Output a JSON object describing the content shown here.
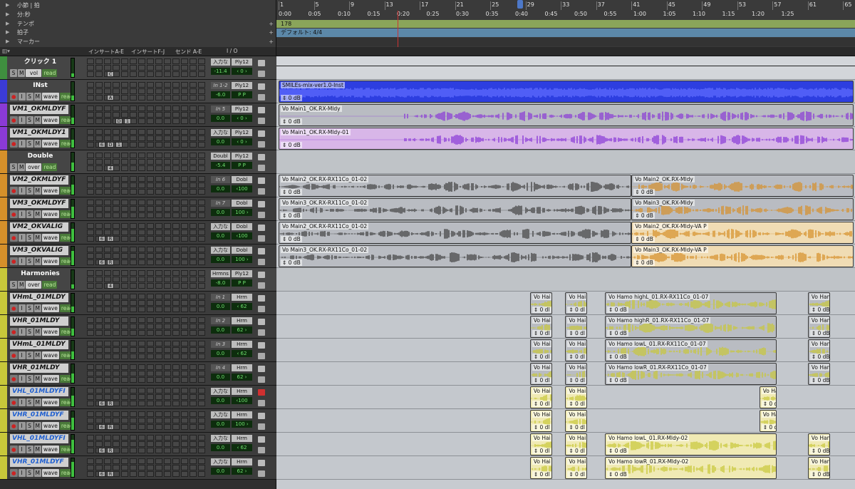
{
  "ruler": {
    "rows": [
      {
        "label": "小節 | 拍",
        "has_plus": false
      },
      {
        "label": "分:秒",
        "has_plus": false
      },
      {
        "label": "テンポ",
        "has_plus": true
      },
      {
        "label": "拍子",
        "has_plus": true
      },
      {
        "label": "マーカー",
        "has_plus": true
      }
    ],
    "bars": [
      "1",
      "5",
      "9",
      "13",
      "17",
      "21",
      "25",
      "29",
      "33",
      "37",
      "41",
      "45",
      "49",
      "53",
      "57",
      "61",
      "65"
    ],
    "minsec": [
      "0:00",
      "0:05",
      "0:10",
      "0:15",
      "0:20",
      "0:25",
      "0:30",
      "0:35",
      "0:40",
      "0:45",
      "0:50",
      "0:55",
      "1:00",
      "1:05",
      "1:10",
      "1:15",
      "1:20",
      "1:25"
    ],
    "tempo": "178",
    "meter": "デフォルト: 4/4"
  },
  "columns": {
    "insert_ae": "インサートA-E",
    "insert_fj": "インサートF-J",
    "send_ae": "センド A-E",
    "io": "I / O"
  },
  "tracks": [
    {
      "name": "クリック 1",
      "type": "master",
      "color": "#3f8f3f",
      "mode": "vol",
      "auto": "read",
      "in": "入力な",
      "out": "Ply12",
      "vol": "-11.4",
      "pan": "‹ 0 ›",
      "inserts": [
        "",
        "C"
      ],
      "buttons": [
        "S",
        "M"
      ]
    },
    {
      "name": "INst",
      "type": "master",
      "color": "#3b3bd6",
      "mode": "wave",
      "auto": "read",
      "in": "In 1-2",
      "out": "Ply12",
      "vol": "-6.0",
      "pan": "P  P",
      "inserts": [
        "",
        "A"
      ],
      "buttons": [
        "●",
        "I",
        "S",
        "M"
      ]
    },
    {
      "name": "VM1_OKMLDYF",
      "type": "audio",
      "color": "#8a3ad6",
      "mode": "wave",
      "auto": "read",
      "in": "In 5",
      "out": "Ply12",
      "vol": "0.0",
      "pan": "‹ 0 ›",
      "inserts": [
        "",
        ""
      ],
      "buttons": [
        "●",
        "I",
        "S",
        "M"
      ],
      "extra": [
        "D",
        "1"
      ]
    },
    {
      "name": "VM1_OKMLDY1",
      "type": "audio",
      "color": "#8a3ad6",
      "mode": "wave",
      "auto": "read",
      "in": "入力な",
      "out": "Ply12",
      "vol": "0.0",
      "pan": "‹ 0 ›",
      "inserts": [
        "6",
        "D",
        "1"
      ],
      "buttons": [
        "●",
        "I",
        "S",
        "M"
      ]
    },
    {
      "name": "Double",
      "type": "master",
      "color": "#d6902a",
      "mode": "over",
      "auto": "read",
      "in": "Doubl",
      "out": "Ply12",
      "vol": "-5.4",
      "pan": "P  P",
      "inserts": [
        "",
        "4"
      ],
      "buttons": [
        "S",
        "M"
      ]
    },
    {
      "name": "VM2_OKMLDYF",
      "type": "audio",
      "color": "#d6902a",
      "mode": "wave",
      "auto": "read",
      "in": "In 6",
      "out": "Dobl",
      "vol": "0.0",
      "pan": "‹100",
      "inserts": [],
      "buttons": [
        "●",
        "I",
        "S",
        "M"
      ]
    },
    {
      "name": "VM3_OKMLDYF",
      "type": "audio",
      "color": "#d6902a",
      "mode": "wave",
      "auto": "read",
      "in": "In 7",
      "out": "Dobl",
      "vol": "0.0",
      "pan": "100 ›",
      "inserts": [],
      "buttons": [
        "●",
        "I",
        "S",
        "M"
      ]
    },
    {
      "name": "VM2_OKVALIG",
      "type": "audio",
      "color": "#d6902a",
      "mode": "wave",
      "auto": "read",
      "in": "入力な",
      "out": "Dobl",
      "vol": "0.0",
      "pan": "‹100",
      "inserts": [
        "6",
        "R"
      ],
      "buttons": [
        "●",
        "I",
        "S",
        "M"
      ]
    },
    {
      "name": "VM3_OKVALIG",
      "type": "audio",
      "color": "#d6902a",
      "mode": "wave",
      "auto": "read",
      "in": "入力な",
      "out": "Dobl",
      "vol": "0.0",
      "pan": "100 ›",
      "inserts": [
        "6",
        "R"
      ],
      "buttons": [
        "●",
        "I",
        "S",
        "M"
      ]
    },
    {
      "name": "Harmonies",
      "type": "master",
      "color": "#c8c83a",
      "mode": "over",
      "auto": "read",
      "in": "Hrmns",
      "out": "Ply12",
      "vol": "-8.0",
      "pan": "P  P",
      "inserts": [
        "",
        "4"
      ],
      "buttons": [
        "S",
        "M"
      ]
    },
    {
      "name": "VHmL_01MLDY",
      "type": "audio",
      "color": "#c8c83a",
      "mode": "wave",
      "auto": "read",
      "in": "In 1",
      "out": "Hrm",
      "vol": "0.0",
      "pan": "‹ 62",
      "inserts": [],
      "buttons": [
        "●",
        "I",
        "S",
        "M"
      ]
    },
    {
      "name": "VHR_01MLDY",
      "type": "audio",
      "color": "#c8c83a",
      "mode": "wave",
      "auto": "read",
      "in": "In 2",
      "out": "Hrm",
      "vol": "0.0",
      "pan": "62 ›",
      "inserts": [],
      "buttons": [
        "●",
        "I",
        "S",
        "M"
      ]
    },
    {
      "name": "VHmL_01MLDY",
      "type": "audio",
      "color": "#c8c83a",
      "mode": "wave",
      "auto": "read",
      "in": "In 3",
      "out": "Hrm",
      "vol": "0.0",
      "pan": "‹ 62",
      "inserts": [],
      "buttons": [
        "●",
        "I",
        "S",
        "M"
      ]
    },
    {
      "name": "VHR_01MLDY",
      "type": "audio",
      "color": "#c8c83a",
      "mode": "wave",
      "auto": "read",
      "in": "In 4",
      "out": "Hrm",
      "vol": "0.0",
      "pan": "62 ›",
      "inserts": [],
      "buttons": [
        "●",
        "I",
        "S",
        "M"
      ]
    },
    {
      "name": "VHL_01MLDYFI",
      "type": "audio",
      "color": "#c8c83a",
      "mode": "wave",
      "auto": "read",
      "in": "入力な",
      "out": "Hrm",
      "vol": "0.0",
      "pan": "‹100",
      "inserts": [
        "6",
        "R"
      ],
      "buttons": [
        "●",
        "I",
        "S",
        "M"
      ],
      "blue": true,
      "red_comment": true
    },
    {
      "name": "VHR_01MLDYF",
      "type": "audio",
      "color": "#c8c83a",
      "mode": "wave",
      "auto": "read",
      "in": "入力な",
      "out": "Hrm",
      "vol": "0.0",
      "pan": "100 ›",
      "inserts": [
        "6",
        "R"
      ],
      "buttons": [
        "●",
        "I",
        "S",
        "M"
      ],
      "blue": true
    },
    {
      "name": "VHL_01MLDYFI",
      "type": "audio",
      "color": "#c8c83a",
      "mode": "wave",
      "auto": "read",
      "in": "入力な",
      "out": "Hrm",
      "vol": "0.0",
      "pan": "‹ 62",
      "inserts": [
        "6",
        "R"
      ],
      "buttons": [
        "●",
        "I",
        "S",
        "M"
      ],
      "blue": true
    },
    {
      "name": "VHR_01MLDYF",
      "type": "audio",
      "color": "#c8c83a",
      "mode": "wave",
      "auto": "read",
      "in": "入力な",
      "out": "Hrm",
      "vol": "0.0",
      "pan": "62 ›",
      "inserts": [
        "6",
        "R"
      ],
      "buttons": [
        "●",
        "I",
        "S",
        "M"
      ],
      "blue": true
    }
  ],
  "clips": [
    {
      "lane": 1,
      "name": "SMILEs-mix-ver1.0-Inst",
      "gain": "0 dB",
      "color": "#2d3ee0",
      "wave": "#5f6cff",
      "bar_start": 1,
      "bar_end": 67
    },
    {
      "lane": 2,
      "name": "Vo Main1_OK.RX-Mldy",
      "gain": "0 dB",
      "color": "#b9bcc2",
      "wave": "#8a3ad6",
      "bar_start": 1,
      "bar_end": 67
    },
    {
      "lane": 3,
      "name": "Vo Main1_OK.RX-Mldy-01",
      "gain": "0 dB",
      "color": "#d8b6e8",
      "wave": "#8a3ad6",
      "bar_start": 1,
      "bar_end": 67
    },
    {
      "lane": 5,
      "name": "Vo Main2_OK.RX-RX11Co_01-02",
      "gain": "0 dB",
      "color": "#b9bcc2",
      "wave": "#444",
      "bar_start": 1,
      "bar_end": 41
    },
    {
      "lane": 5,
      "name": "Vo Main2_OK.RX-Mldy",
      "gain": "0 dB",
      "color": "#b9bcc2",
      "wave": "#d6902a",
      "bar_start": 41,
      "bar_end": 67
    },
    {
      "lane": 6,
      "name": "Vo Main3_OK.RX-RX11Co_01-02",
      "gain": "0 dB",
      "color": "#b9bcc2",
      "wave": "#444",
      "bar_start": 1,
      "bar_end": 41
    },
    {
      "lane": 6,
      "name": "Vo Main3_OK.RX-Mldy",
      "gain": "0 dB",
      "color": "#b9bcc2",
      "wave": "#d6902a",
      "bar_start": 41,
      "bar_end": 67
    },
    {
      "lane": 7,
      "name": "Vo Main2_OK.RX-RX11Co_01-02",
      "gain": "0 dB",
      "color": "#b9bcc2",
      "wave": "#444",
      "bar_start": 1,
      "bar_end": 41
    },
    {
      "lane": 7,
      "name": "Vo Main2_OK.RX-Mldy-VA P",
      "gain": "0 dB",
      "color": "#f0dcb4",
      "wave": "#d6902a",
      "bar_start": 41,
      "bar_end": 67
    },
    {
      "lane": 8,
      "name": "Vo Main3_OK.RX-RX11Co_01-02",
      "gain": "0 dB",
      "color": "#b9bcc2",
      "wave": "#444",
      "bar_start": 1,
      "bar_end": 41
    },
    {
      "lane": 8,
      "name": "Vo Main3_OK.RX-Mldy-VA P",
      "gain": "0 dB",
      "color": "#f0dcb4",
      "wave": "#d6902a",
      "bar_start": 41,
      "bar_end": 67
    },
    {
      "lane": 10,
      "name": "Vo Hai",
      "gain": "0 dl",
      "color": "#b9bcc2",
      "wave": "#c8c83a",
      "bar_start": 29.5,
      "bar_end": 32
    },
    {
      "lane": 10,
      "name": "Vo Hai",
      "gain": "0 dl",
      "color": "#b9bcc2",
      "wave": "#c8c83a",
      "bar_start": 33.5,
      "bar_end": 36
    },
    {
      "lane": 10,
      "name": "Vo Hamo highL_01.RX-RX11Co_01-07",
      "gain": "0 dB",
      "color": "#b9bcc2",
      "wave": "#c8c83a",
      "bar_start": 38,
      "bar_end": 57.5
    },
    {
      "lane": 10,
      "name": "Vo Han",
      "gain": "0 dB",
      "color": "#b9bcc2",
      "wave": "#c8c83a",
      "bar_start": 61,
      "bar_end": 63.5
    },
    {
      "lane": 11,
      "name": "Vo Hai",
      "gain": "0 dl",
      "color": "#b9bcc2",
      "wave": "#c8c83a",
      "bar_start": 29.5,
      "bar_end": 32
    },
    {
      "lane": 11,
      "name": "Vo Hai",
      "gain": "0 dl",
      "color": "#b9bcc2",
      "wave": "#c8c83a",
      "bar_start": 33.5,
      "bar_end": 36
    },
    {
      "lane": 11,
      "name": "Vo Hamo highR_01.RX-RX11Co_01-07",
      "gain": "0 dB",
      "color": "#b9bcc2",
      "wave": "#c8c83a",
      "bar_start": 38,
      "bar_end": 57.5
    },
    {
      "lane": 11,
      "name": "Vo Han",
      "gain": "0 dB",
      "color": "#b9bcc2",
      "wave": "#c8c83a",
      "bar_start": 61,
      "bar_end": 63.5
    },
    {
      "lane": 12,
      "name": "Vo Hai",
      "gain": "0 dl",
      "color": "#b9bcc2",
      "wave": "#c8c83a",
      "bar_start": 29.5,
      "bar_end": 32
    },
    {
      "lane": 12,
      "name": "Vo Hai",
      "gain": "0 dl",
      "color": "#b9bcc2",
      "wave": "#c8c83a",
      "bar_start": 33.5,
      "bar_end": 36
    },
    {
      "lane": 12,
      "name": "Vo Hamo lowL_01.RX-RX11Co_01-07",
      "gain": "0 dB",
      "color": "#b9bcc2",
      "wave": "#c8c83a",
      "bar_start": 38,
      "bar_end": 57.5
    },
    {
      "lane": 12,
      "name": "Vo Han",
      "gain": "0 dB",
      "color": "#b9bcc2",
      "wave": "#c8c83a",
      "bar_start": 61,
      "bar_end": 63.5
    },
    {
      "lane": 13,
      "name": "Vo Hai",
      "gain": "0 dl",
      "color": "#b9bcc2",
      "wave": "#c8c83a",
      "bar_start": 29.5,
      "bar_end": 32
    },
    {
      "lane": 13,
      "name": "Vo Hai",
      "gain": "0 dl",
      "color": "#b9bcc2",
      "wave": "#c8c83a",
      "bar_start": 33.5,
      "bar_end": 36
    },
    {
      "lane": 13,
      "name": "Vo Hamo lowR_01.RX-RX11Co_01-07",
      "gain": "0 dB",
      "color": "#b9bcc2",
      "wave": "#c8c83a",
      "bar_start": 38,
      "bar_end": 57.5
    },
    {
      "lane": 13,
      "name": "Vo Han",
      "gain": "0 dB",
      "color": "#b9bcc2",
      "wave": "#c8c83a",
      "bar_start": 61,
      "bar_end": 63.5
    },
    {
      "lane": 14,
      "name": "Vo Hai",
      "gain": "0 dl",
      "color": "#f0eab4",
      "wave": "#c8c83a",
      "bar_start": 29.5,
      "bar_end": 32
    },
    {
      "lane": 14,
      "name": "Vo Hai",
      "gain": "0 dl",
      "color": "#f0eab4",
      "wave": "#c8c83a",
      "bar_start": 33.5,
      "bar_end": 36
    },
    {
      "lane": 14,
      "name": "Vo Har",
      "gain": "0 dl",
      "color": "#f0eab4",
      "wave": "#c8c83a",
      "bar_start": 55.5,
      "bar_end": 57.5
    },
    {
      "lane": 15,
      "name": "Vo Hai",
      "gain": "0 dl",
      "color": "#f0eab4",
      "wave": "#c8c83a",
      "bar_start": 29.5,
      "bar_end": 32
    },
    {
      "lane": 15,
      "name": "Vo Hai",
      "gain": "0 dl",
      "color": "#f0eab4",
      "wave": "#c8c83a",
      "bar_start": 33.5,
      "bar_end": 36
    },
    {
      "lane": 15,
      "name": "Vo Har",
      "gain": "0 dl",
      "color": "#f0eab4",
      "wave": "#c8c83a",
      "bar_start": 55.5,
      "bar_end": 57.5
    },
    {
      "lane": 16,
      "name": "Vo Hai",
      "gain": "0 dl",
      "color": "#f0eab4",
      "wave": "#c8c83a",
      "bar_start": 29.5,
      "bar_end": 32
    },
    {
      "lane": 16,
      "name": "Vo Hai",
      "gain": "0 dl",
      "color": "#f0eab4",
      "wave": "#c8c83a",
      "bar_start": 33.5,
      "bar_end": 36
    },
    {
      "lane": 16,
      "name": "Vo Hamo lowL_01.RX-Mldy-02",
      "gain": "0 dB",
      "color": "#f0eab4",
      "wave": "#c8c83a",
      "bar_start": 38,
      "bar_end": 57.5
    },
    {
      "lane": 16,
      "name": "Vo Han",
      "gain": "0 dB",
      "color": "#f0eab4",
      "wave": "#c8c83a",
      "bar_start": 61,
      "bar_end": 63.5
    },
    {
      "lane": 17,
      "name": "Vo Hai",
      "gain": "0 dl",
      "color": "#f0eab4",
      "wave": "#c8c83a",
      "bar_start": 29.5,
      "bar_end": 32
    },
    {
      "lane": 17,
      "name": "Vo Hai",
      "gain": "0 dl",
      "color": "#f0eab4",
      "wave": "#c8c83a",
      "bar_start": 33.5,
      "bar_end": 36
    },
    {
      "lane": 17,
      "name": "Vo Hamo lowR_01.RX-Mldy-02",
      "gain": "0 dB",
      "color": "#f0eab4",
      "wave": "#c8c83a",
      "bar_start": 38,
      "bar_end": 57.5
    },
    {
      "lane": 17,
      "name": "Vo Han",
      "gain": "0 dB",
      "color": "#f0eab4",
      "wave": "#c8c83a",
      "bar_start": 61,
      "bar_end": 63.5
    }
  ]
}
